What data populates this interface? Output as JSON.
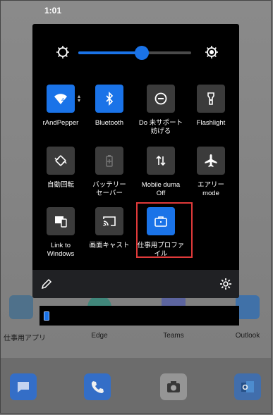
{
  "status_bar": {
    "time": "1:01"
  },
  "quick_settings": {
    "brightness": {
      "level": 0.56
    },
    "tiles": [
      {
        "label": "rAndPepper",
        "icon": "wifi-icon",
        "active": true
      },
      {
        "label": "Bluetooth",
        "icon": "bluetooth-icon",
        "active": true
      },
      {
        "label": "Do 未サポート\n妨げる",
        "icon": "do-not-disturb-icon",
        "active": false
      },
      {
        "label": "Flashlight",
        "icon": "flashlight-icon",
        "active": false
      },
      {
        "label": "自動回転",
        "icon": "auto-rotate-icon",
        "active": false
      },
      {
        "label": "バッテリー\nセーバー",
        "icon": "battery-saver-icon",
        "active": false
      },
      {
        "label": "Mobile duma\nOff",
        "icon": "mobile-data-icon",
        "active": false
      },
      {
        "label": "エアリー\nmode",
        "icon": "airplane-icon",
        "active": false
      },
      {
        "label": "Link to\nWindows",
        "icon": "link-to-windows-icon",
        "active": false
      },
      {
        "label": "画面キャスト",
        "icon": "cast-icon",
        "active": false
      },
      {
        "label": "仕事用プロファイル",
        "icon": "briefcase-icon",
        "active": true
      }
    ]
  },
  "home_apps": [
    {
      "label": "仕事用アプリ"
    },
    {
      "label": "Edge"
    },
    {
      "label": "Teams"
    },
    {
      "label": "Outlook"
    }
  ],
  "colors": {
    "accent": "#1a73e8",
    "highlight": "#e03a3a",
    "panel": "#000000"
  }
}
